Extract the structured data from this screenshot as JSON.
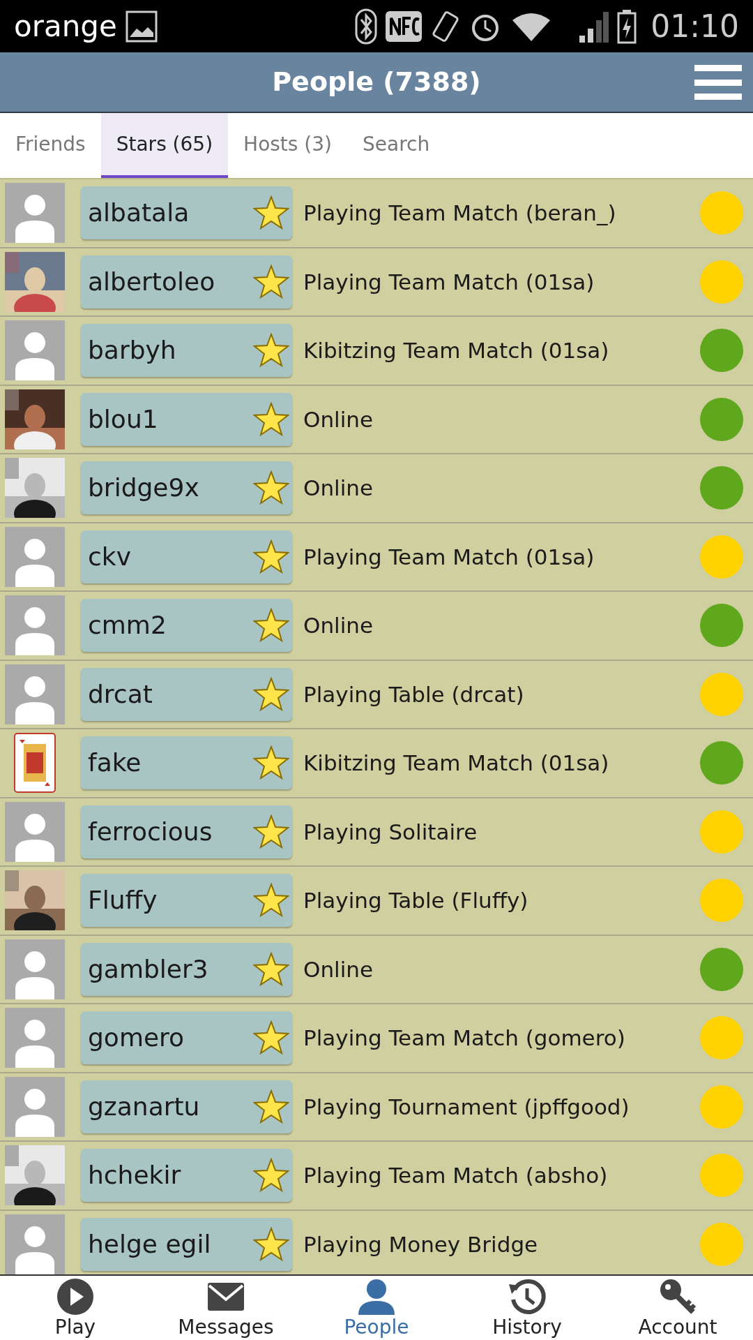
{
  "status_bar": {
    "carrier": "orange",
    "time": "01:10"
  },
  "header": {
    "title": "People (7388)"
  },
  "tabs": [
    {
      "label": "Friends",
      "selected": false
    },
    {
      "label": "Stars (65)",
      "selected": true
    },
    {
      "label": "Hosts (3)",
      "selected": false
    },
    {
      "label": "Search",
      "selected": false
    }
  ],
  "people": [
    {
      "name": "albatala",
      "kind": "placeholder",
      "status": "Playing Team Match (beran_)",
      "color": "#ffd200"
    },
    {
      "name": "albertoleo",
      "kind": "picture",
      "status": "Playing Team Match (01sa)",
      "color": "#ffd200"
    },
    {
      "name": "barbyh",
      "kind": "placeholder",
      "status": "Kibitzing Team Match (01sa)",
      "color": "#5fa71c"
    },
    {
      "name": "blou1",
      "kind": "picture",
      "status": "Online",
      "color": "#5fa71c"
    },
    {
      "name": "bridge9x",
      "kind": "picture",
      "status": "Online",
      "color": "#5fa71c"
    },
    {
      "name": "ckv",
      "kind": "placeholder",
      "status": "Playing Team Match (01sa)",
      "color": "#ffd200"
    },
    {
      "name": "cmm2",
      "kind": "placeholder",
      "status": "Online",
      "color": "#5fa71c"
    },
    {
      "name": "drcat",
      "kind": "placeholder",
      "status": "Playing Table (drcat)",
      "color": "#ffd200"
    },
    {
      "name": "fake",
      "kind": "card",
      "status": "Kibitzing Team Match (01sa)",
      "color": "#5fa71c"
    },
    {
      "name": "ferrocious",
      "kind": "placeholder",
      "status": "Playing Solitaire",
      "color": "#ffd200"
    },
    {
      "name": "Fluffy",
      "kind": "picture",
      "status": "Playing Table (Fluffy)",
      "color": "#ffd200"
    },
    {
      "name": "gambler3",
      "kind": "placeholder",
      "status": "Online",
      "color": "#5fa71c"
    },
    {
      "name": "gomero",
      "kind": "placeholder",
      "status": "Playing Team Match (gomero)",
      "color": "#ffd200"
    },
    {
      "name": "gzanartu",
      "kind": "placeholder",
      "status": "Playing Tournament (jpffgood)",
      "color": "#ffd200"
    },
    {
      "name": "hchekir",
      "kind": "picture",
      "status": "Playing Team Match (absho)",
      "color": "#ffd200"
    },
    {
      "name": "helge egil",
      "kind": "placeholder",
      "status": "Playing Money Bridge",
      "color": "#ffd200"
    }
  ],
  "nav": [
    {
      "label": "Play",
      "selected": false
    },
    {
      "label": "Messages",
      "selected": false
    },
    {
      "label": "People",
      "selected": true
    },
    {
      "label": "History",
      "selected": false
    },
    {
      "label": "Account",
      "selected": false
    }
  ]
}
